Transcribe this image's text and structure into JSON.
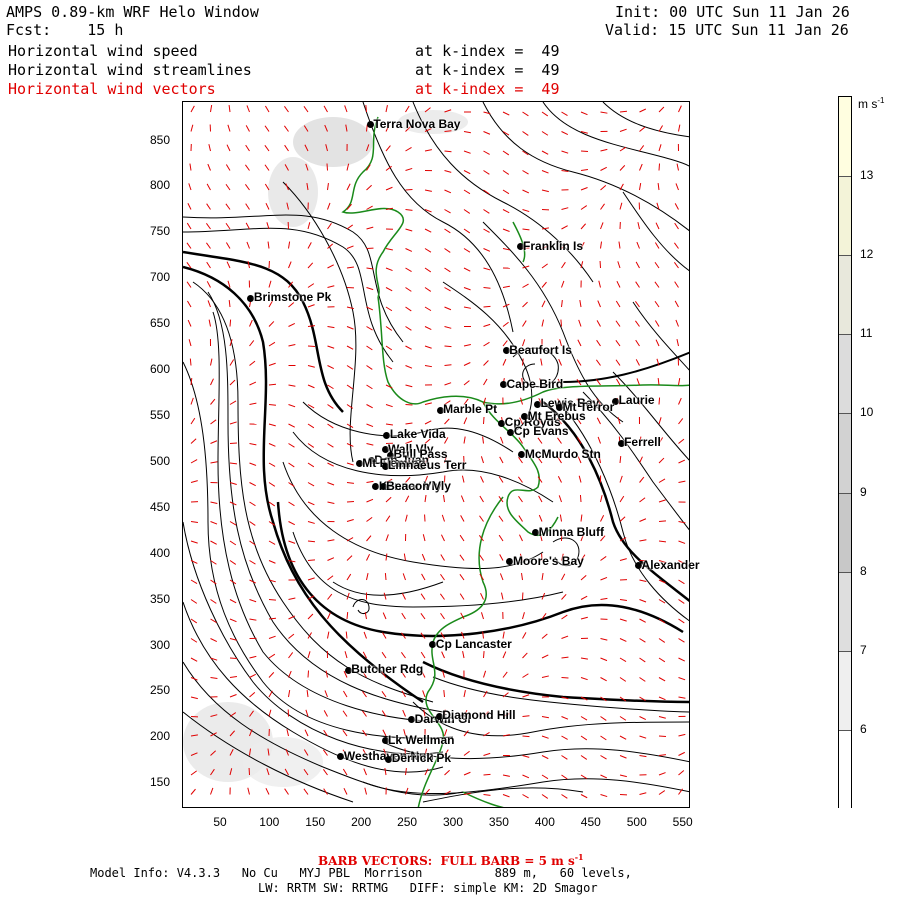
{
  "header": {
    "title": "AMPS 0.89-km WRF Helo Window",
    "fcst_label": "Fcst:",
    "fcst_value": "15 h",
    "init": "Init: 00 UTC Sun 11 Jan 26",
    "valid": "Valid: 15 UTC Sun 11 Jan 26",
    "fields": [
      {
        "name": "Horizontal wind speed",
        "level": "at k-index =  49",
        "color": "#000000"
      },
      {
        "name": "Horizontal wind streamlines",
        "level": "at k-index =  49",
        "color": "#000000"
      },
      {
        "name": "Horizontal wind vectors",
        "level": "at k-index =  49",
        "color": "#e00000"
      }
    ]
  },
  "axes": {
    "x_ticks": [
      "50",
      "100",
      "150",
      "200",
      "250",
      "300",
      "350",
      "400",
      "450",
      "500",
      "550"
    ],
    "y_ticks": [
      "850",
      "800",
      "750",
      "700",
      "650",
      "600",
      "550",
      "500",
      "450",
      "400",
      "350",
      "300",
      "250",
      "200",
      "150"
    ]
  },
  "colorbar": {
    "unit": "m s",
    "unit_exp": "-1",
    "ticks": [
      "13",
      "12",
      "11",
      "10",
      "9",
      "8",
      "7",
      "6"
    ],
    "colors": [
      "#fffee0",
      "#f3f3d8",
      "#e8e8dc",
      "#dcdcdc",
      "#d2d2d2",
      "#c8c8c8",
      "#dedede",
      "#efefef",
      "#ffffff"
    ]
  },
  "places": [
    {
      "name": "Terra Nova Bay",
      "x": 210,
      "y": 866
    },
    {
      "name": "Franklin Is",
      "x": 373,
      "y": 733
    },
    {
      "name": "Brimstone Pk",
      "x": 80,
      "y": 677
    },
    {
      "name": "Beaufort Is",
      "x": 358,
      "y": 620
    },
    {
      "name": "Cape Bird",
      "x": 355,
      "y": 583
    },
    {
      "name": "Lewis Bay",
      "x": 392,
      "y": 562
    },
    {
      "name": "Laurie",
      "x": 477,
      "y": 565
    },
    {
      "name": "Mt Terror",
      "x": 416,
      "y": 558
    },
    {
      "name": "Marble Pt",
      "x": 286,
      "y": 555
    },
    {
      "name": "Cp Royds",
      "x": 353,
      "y": 541
    },
    {
      "name": "Mt Erebus",
      "x": 378,
      "y": 548
    },
    {
      "name": "Lake Vida",
      "x": 228,
      "y": 528
    },
    {
      "name": "Cp Evans",
      "x": 363,
      "y": 531
    },
    {
      "name": "Ferrell",
      "x": 483,
      "y": 519
    },
    {
      "name": "Wall Vly",
      "x": 226,
      "y": 512
    },
    {
      "name": "McMurdo Stn",
      "x": 375,
      "y": 507
    },
    {
      "name": "Bull Pass",
      "x": 232,
      "y": 506
    },
    {
      "name": "Don Juan",
      "x": 211,
      "y": 500
    },
    {
      "name": "Mt Fleming",
      "x": 198,
      "y": 497
    },
    {
      "name": "Linnaeus Terr",
      "x": 226,
      "y": 494
    },
    {
      "name": "Kennar Vly",
      "x": 216,
      "y": 472
    },
    {
      "name": "Beacon Vly",
      "x": 224,
      "y": 472
    },
    {
      "name": "Minna Bluff",
      "x": 390,
      "y": 422
    },
    {
      "name": "Moore's Bay",
      "x": 362,
      "y": 390
    },
    {
      "name": "Alexander",
      "x": 502,
      "y": 386
    },
    {
      "name": "Cp Lancaster",
      "x": 278,
      "y": 300
    },
    {
      "name": "Butcher Rdg",
      "x": 186,
      "y": 272
    },
    {
      "name": "Darwin Gl",
      "x": 255,
      "y": 218
    },
    {
      "name": "Diamond Hill",
      "x": 285,
      "y": 222
    },
    {
      "name": "Lk Wellman",
      "x": 226,
      "y": 195
    },
    {
      "name": "Westhaven Nun",
      "x": 178,
      "y": 178
    },
    {
      "name": "Derrick Pk",
      "x": 230,
      "y": 175
    }
  ],
  "footer": {
    "barb_label": "BARB VECTORS:  FULL BARB = 5 m s",
    "barb_exp": "-1",
    "model_line1": "Model Info: V4.3.3   No Cu   MYJ PBL  Morrison          889 m,   60 levels,",
    "model_line2": "LW: RRTM SW: RRTMG   DIFF: simple KM: 2D Smagor"
  },
  "colors": {
    "coast": "#1a8a1a",
    "barbs": "#e00000",
    "streamlines": "#000000"
  }
}
